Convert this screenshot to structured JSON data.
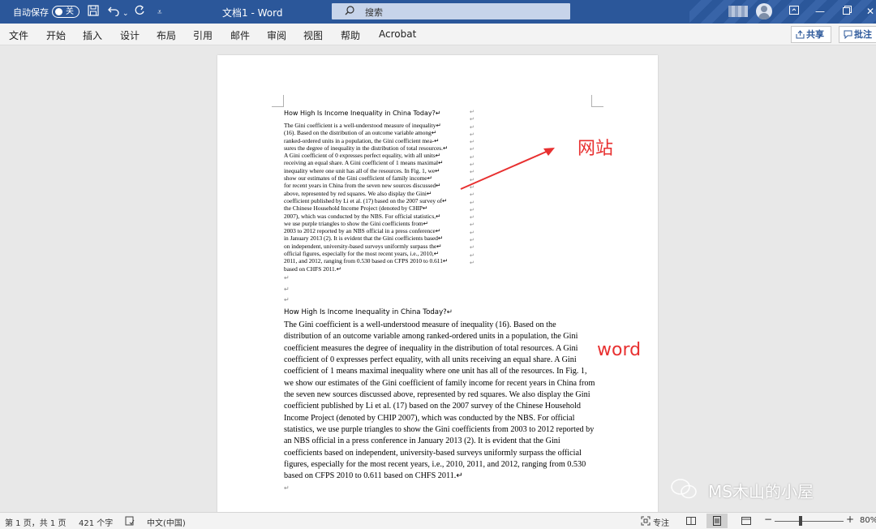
{
  "titlebar": {
    "autosave_label": "自动保存",
    "autosave_state": "关",
    "doc_title": "文档1  -  Word",
    "search_placeholder": "搜索"
  },
  "ribbon": {
    "tabs": [
      "文件",
      "开始",
      "插入",
      "设计",
      "布局",
      "引用",
      "邮件",
      "审阅",
      "视图",
      "帮助",
      "Acrobat"
    ],
    "share_label": "共享",
    "comment_label": "批注"
  },
  "document": {
    "title_small": "How High Is Income Inequality in China Today?↵",
    "small_lines": [
      "The Gini coefficient is a well-understood measure of inequality↵",
      "(16). Based on the distribution of an outcome variable among↵",
      "ranked-ordered units in a population, the Gini coefficient mea-↵",
      "sures the degree of inequality in the distribution of total resources.↵",
      "A Gini coefficient of 0 expresses perfect equality, with all units↵",
      "receiving an equal share. A Gini coefficient of 1 means maximal↵",
      "inequality where one unit has all of the resources. In Fig. 1, we↵",
      "show our estimates of the Gini coefficient of family income↵",
      "for recent years in China from the seven new sources discussed↵",
      "above, represented by red squares. We also display the Gini↵",
      "coefficient published by Li et al. (17) based on the 2007 survey of↵",
      "the Chinese Household Income Project (denoted by CHIP↵",
      "2007), which was conducted by the NBS. For official statistics,↵",
      "we use purple triangles to show the Gini coefficients from↵",
      "2003 to 2012 reported by an NBS official in a press conference↵",
      "in January 2013 (2). It is evident that the Gini coefficients based↵",
      "on independent, university-based surveys uniformly surpass the↵",
      "official figures, especially for the most recent years, i.e., 2010,↵",
      "2011, and 2012, ranging from 0.530 based on CFPS 2010 to 0.611↵",
      "based on CHFS 2011.↵"
    ],
    "title_large": "How High Is Income Inequality in China Today?↵",
    "large_lines": [
      "The Gini coefficient is a well-understood measure of inequality (16). Based on the",
      "distribution of an outcome variable among ranked-ordered units in a population, the Gini",
      "coefficient measures the degree of inequality in the distribution of total resources. A Gini",
      "coefficient of 0 expresses perfect equality, with all units receiving an equal share. A Gini",
      "coefficient of 1 means maximal inequality where one unit has all of the resources. In Fig. 1,",
      "we show our estimates of the Gini coefficient of family income for recent years in China from",
      "the seven new sources discussed above, represented by red squares. We also display the Gini",
      "coefficient published by Li et al. (17) based on the 2007 survey of the Chinese Household",
      "Income Project (denoted by CHIP 2007), which was conducted by the NBS. For official",
      "statistics, we use purple triangles to show the Gini coefficients from 2003 to 2012 reported by",
      "an NBS official in a press conference in January 2013 (2). It is evident that the Gini",
      "coefficients based on independent, university-based surveys uniformly surpass the official",
      "figures, especially for the most recent years, i.e., 2010, 2011, and 2012, ranging from 0.530",
      "based on CFPS 2010 to 0.611 based on CHFS 2011.↵"
    ],
    "paragraph_mark": "↵"
  },
  "annotations": {
    "website_label": "网站",
    "word_label": "word",
    "accent": "#e83030"
  },
  "watermark": "MS木山的小屋",
  "statusbar": {
    "page_info": "第 1 页，共 1 页",
    "word_count": "421 个字",
    "language": "中文(中国)",
    "focus_label": "专注",
    "zoom_minus": "−",
    "zoom_plus": "+",
    "zoom_level": "80%"
  },
  "colors": {
    "titlebar": "#2b579a",
    "ribbon": "#f3f3f3",
    "canvas": "#e8e8e8"
  }
}
